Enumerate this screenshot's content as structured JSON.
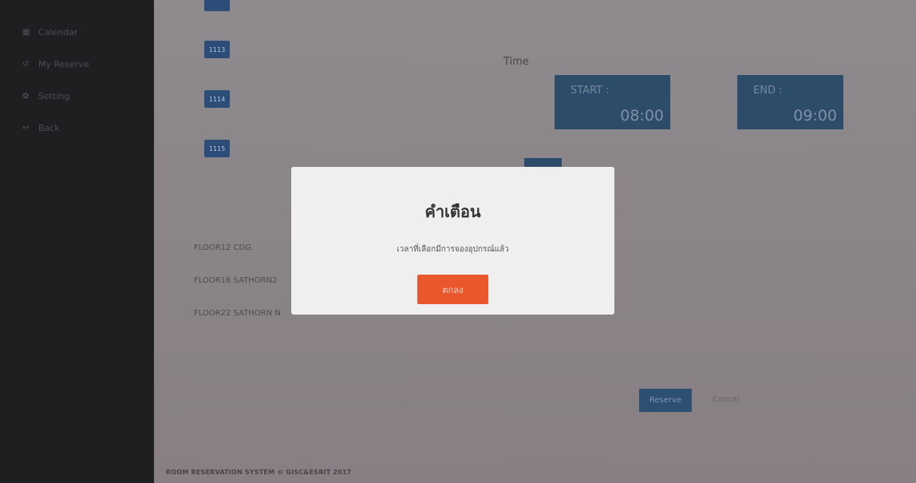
{
  "sidebar": {
    "items": [
      {
        "icon": "calendar-icon",
        "glyph": "▦",
        "label": "Calendar"
      },
      {
        "icon": "history-icon",
        "glyph": "↺",
        "label": "My Reserve"
      },
      {
        "icon": "gear-icon",
        "glyph": "✿",
        "label": "Setting"
      },
      {
        "icon": "back-icon",
        "glyph": "↩",
        "label": "Back"
      }
    ]
  },
  "rooms": [
    "1113",
    "1114",
    "1115"
  ],
  "time": {
    "label": "Time",
    "start_label": "START :",
    "start_value": "08:00",
    "end_label": "END :",
    "end_value": "09:00"
  },
  "floors": [
    "FLOOR12 CDG",
    "FLOOR16 SATHORN2",
    "FLOOR22 SATHORN N"
  ],
  "actions": {
    "reserve": "Reserve",
    "cancel": "Cancel"
  },
  "footer": "ROOM RESERVATION SYSTEM © GISC&ESRIT 2017",
  "modal": {
    "title": "คำเตือน",
    "message": "เวลาที่เลือกมีการจองอุปกรณ์แล้ว",
    "ok": "ตกลง"
  },
  "colors": {
    "accent": "#e8582c",
    "primary": "#2b4d78",
    "sidebar": "#1f1f22"
  }
}
